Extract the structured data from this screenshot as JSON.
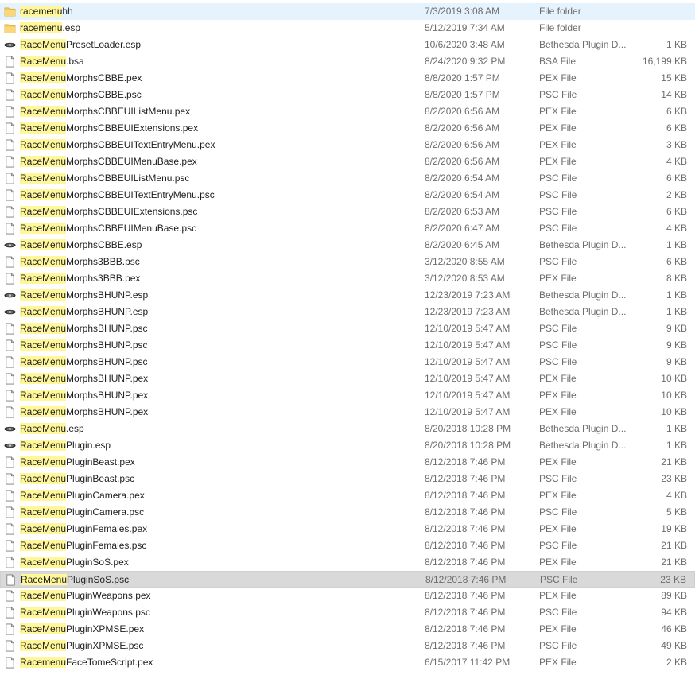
{
  "files": [
    {
      "prefix": "racemenu",
      "rest": "hh",
      "date": "7/3/2019 3:08 AM",
      "type": "File folder",
      "size": "",
      "icon": "folder-icon"
    },
    {
      "prefix": "racemenu",
      "rest": ".esp",
      "date": "5/12/2019 7:34 AM",
      "type": "File folder",
      "size": "",
      "icon": "folder-icon"
    },
    {
      "prefix": "RaceMenu",
      "rest": "PresetLoader.esp",
      "date": "10/6/2020 3:48 AM",
      "type": "Bethesda Plugin D...",
      "size": "1 KB",
      "icon": "plugin-icon"
    },
    {
      "prefix": "RaceMenu",
      "rest": ".bsa",
      "date": "8/24/2020 9:32 PM",
      "type": "BSA File",
      "size": "16,199 KB",
      "icon": "file-icon"
    },
    {
      "prefix": "RaceMenu",
      "rest": "MorphsCBBE.pex",
      "date": "8/8/2020 1:57 PM",
      "type": "PEX File",
      "size": "15 KB",
      "icon": "file-icon"
    },
    {
      "prefix": "RaceMenu",
      "rest": "MorphsCBBE.psc",
      "date": "8/8/2020 1:57 PM",
      "type": "PSC File",
      "size": "14 KB",
      "icon": "file-icon"
    },
    {
      "prefix": "RaceMenu",
      "rest": "MorphsCBBEUIListMenu.pex",
      "date": "8/2/2020 6:56 AM",
      "type": "PEX File",
      "size": "6 KB",
      "icon": "file-icon"
    },
    {
      "prefix": "RaceMenu",
      "rest": "MorphsCBBEUIExtensions.pex",
      "date": "8/2/2020 6:56 AM",
      "type": "PEX File",
      "size": "6 KB",
      "icon": "file-icon"
    },
    {
      "prefix": "RaceMenu",
      "rest": "MorphsCBBEUITextEntryMenu.pex",
      "date": "8/2/2020 6:56 AM",
      "type": "PEX File",
      "size": "3 KB",
      "icon": "file-icon"
    },
    {
      "prefix": "RaceMenu",
      "rest": "MorphsCBBEUIMenuBase.pex",
      "date": "8/2/2020 6:56 AM",
      "type": "PEX File",
      "size": "4 KB",
      "icon": "file-icon"
    },
    {
      "prefix": "RaceMenu",
      "rest": "MorphsCBBEUIListMenu.psc",
      "date": "8/2/2020 6:54 AM",
      "type": "PSC File",
      "size": "6 KB",
      "icon": "file-icon"
    },
    {
      "prefix": "RaceMenu",
      "rest": "MorphsCBBEUITextEntryMenu.psc",
      "date": "8/2/2020 6:54 AM",
      "type": "PSC File",
      "size": "2 KB",
      "icon": "file-icon"
    },
    {
      "prefix": "RaceMenu",
      "rest": "MorphsCBBEUIExtensions.psc",
      "date": "8/2/2020 6:53 AM",
      "type": "PSC File",
      "size": "6 KB",
      "icon": "file-icon"
    },
    {
      "prefix": "RaceMenu",
      "rest": "MorphsCBBEUIMenuBase.psc",
      "date": "8/2/2020 6:47 AM",
      "type": "PSC File",
      "size": "4 KB",
      "icon": "file-icon"
    },
    {
      "prefix": "RaceMenu",
      "rest": "MorphsCBBE.esp",
      "date": "8/2/2020 6:45 AM",
      "type": "Bethesda Plugin D...",
      "size": "1 KB",
      "icon": "plugin-icon"
    },
    {
      "prefix": "RaceMenu",
      "rest": "Morphs3BBB.psc",
      "date": "3/12/2020 8:55 AM",
      "type": "PSC File",
      "size": "6 KB",
      "icon": "file-icon"
    },
    {
      "prefix": "RaceMenu",
      "rest": "Morphs3BBB.pex",
      "date": "3/12/2020 8:53 AM",
      "type": "PEX File",
      "size": "8 KB",
      "icon": "file-icon"
    },
    {
      "prefix": "RaceMenu",
      "rest": "MorphsBHUNP.esp",
      "date": "12/23/2019 7:23 AM",
      "type": "Bethesda Plugin D...",
      "size": "1 KB",
      "icon": "plugin-icon"
    },
    {
      "prefix": "RaceMenu",
      "rest": "MorphsBHUNP.esp",
      "date": "12/23/2019 7:23 AM",
      "type": "Bethesda Plugin D...",
      "size": "1 KB",
      "icon": "plugin-icon"
    },
    {
      "prefix": "RaceMenu",
      "rest": "MorphsBHUNP.psc",
      "date": "12/10/2019 5:47 AM",
      "type": "PSC File",
      "size": "9 KB",
      "icon": "file-icon"
    },
    {
      "prefix": "RaceMenu",
      "rest": "MorphsBHUNP.psc",
      "date": "12/10/2019 5:47 AM",
      "type": "PSC File",
      "size": "9 KB",
      "icon": "file-icon"
    },
    {
      "prefix": "RaceMenu",
      "rest": "MorphsBHUNP.psc",
      "date": "12/10/2019 5:47 AM",
      "type": "PSC File",
      "size": "9 KB",
      "icon": "file-icon"
    },
    {
      "prefix": "RaceMenu",
      "rest": "MorphsBHUNP.pex",
      "date": "12/10/2019 5:47 AM",
      "type": "PEX File",
      "size": "10 KB",
      "icon": "file-icon"
    },
    {
      "prefix": "RaceMenu",
      "rest": "MorphsBHUNP.pex",
      "date": "12/10/2019 5:47 AM",
      "type": "PEX File",
      "size": "10 KB",
      "icon": "file-icon"
    },
    {
      "prefix": "RaceMenu",
      "rest": "MorphsBHUNP.pex",
      "date": "12/10/2019 5:47 AM",
      "type": "PEX File",
      "size": "10 KB",
      "icon": "file-icon"
    },
    {
      "prefix": "RaceMenu",
      "rest": ".esp",
      "date": "8/20/2018 10:28 PM",
      "type": "Bethesda Plugin D...",
      "size": "1 KB",
      "icon": "plugin-icon"
    },
    {
      "prefix": "RaceMenu",
      "rest": "Plugin.esp",
      "date": "8/20/2018 10:28 PM",
      "type": "Bethesda Plugin D...",
      "size": "1 KB",
      "icon": "plugin-icon"
    },
    {
      "prefix": "RaceMenu",
      "rest": "PluginBeast.pex",
      "date": "8/12/2018 7:46 PM",
      "type": "PEX File",
      "size": "21 KB",
      "icon": "file-icon"
    },
    {
      "prefix": "RaceMenu",
      "rest": "PluginBeast.psc",
      "date": "8/12/2018 7:46 PM",
      "type": "PSC File",
      "size": "23 KB",
      "icon": "file-icon"
    },
    {
      "prefix": "RaceMenu",
      "rest": "PluginCamera.pex",
      "date": "8/12/2018 7:46 PM",
      "type": "PEX File",
      "size": "4 KB",
      "icon": "file-icon"
    },
    {
      "prefix": "RaceMenu",
      "rest": "PluginCamera.psc",
      "date": "8/12/2018 7:46 PM",
      "type": "PSC File",
      "size": "5 KB",
      "icon": "file-icon"
    },
    {
      "prefix": "RaceMenu",
      "rest": "PluginFemales.pex",
      "date": "8/12/2018 7:46 PM",
      "type": "PEX File",
      "size": "19 KB",
      "icon": "file-icon"
    },
    {
      "prefix": "RaceMenu",
      "rest": "PluginFemales.psc",
      "date": "8/12/2018 7:46 PM",
      "type": "PSC File",
      "size": "21 KB",
      "icon": "file-icon"
    },
    {
      "prefix": "RaceMenu",
      "rest": "PluginSoS.pex",
      "date": "8/12/2018 7:46 PM",
      "type": "PEX File",
      "size": "21 KB",
      "icon": "file-icon"
    },
    {
      "prefix": "RaceMenu",
      "rest": "PluginSoS.psc",
      "date": "8/12/2018 7:46 PM",
      "type": "PSC File",
      "size": "23 KB",
      "icon": "file-icon",
      "selected": true
    },
    {
      "prefix": "RaceMenu",
      "rest": "PluginWeapons.pex",
      "date": "8/12/2018 7:46 PM",
      "type": "PEX File",
      "size": "89 KB",
      "icon": "file-icon"
    },
    {
      "prefix": "RaceMenu",
      "rest": "PluginWeapons.psc",
      "date": "8/12/2018 7:46 PM",
      "type": "PSC File",
      "size": "94 KB",
      "icon": "file-icon"
    },
    {
      "prefix": "RaceMenu",
      "rest": "PluginXPMSE.pex",
      "date": "8/12/2018 7:46 PM",
      "type": "PEX File",
      "size": "46 KB",
      "icon": "file-icon"
    },
    {
      "prefix": "RaceMenu",
      "rest": "PluginXPMSE.psc",
      "date": "8/12/2018 7:46 PM",
      "type": "PSC File",
      "size": "49 KB",
      "icon": "file-icon"
    },
    {
      "prefix": "Racemenu",
      "rest": "FaceTomeScript.pex",
      "date": "6/15/2017 11:42 PM",
      "type": "PEX File",
      "size": "2 KB",
      "icon": "file-icon"
    }
  ],
  "hover_row": 0,
  "colors": {
    "highlight": "#fff79a",
    "selected": "#d9d9d9",
    "hover": "#e5f3ff",
    "folder": "#f3c95b"
  }
}
